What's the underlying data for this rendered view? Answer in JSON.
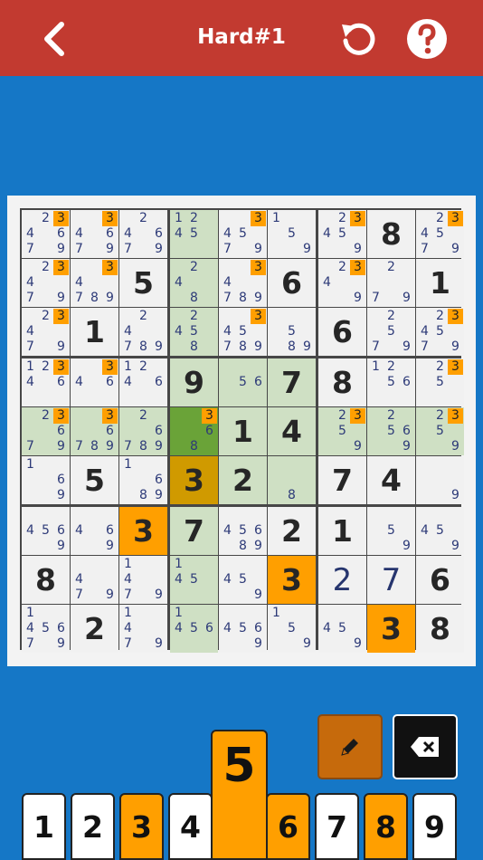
{
  "header": {
    "title": "Hard#1",
    "back_icon": "chevron-left-icon",
    "undo_icon": "undo-icon",
    "help_icon": "help-icon"
  },
  "colors": {
    "topbar": "#c23a30",
    "background": "#1577c6",
    "highlight": "#ff9f00",
    "selected": "#6aa338",
    "block": "#cfe0c4"
  },
  "board": {
    "selected": [
      4,
      3
    ],
    "highlight_number": 3,
    "cells": [
      [
        {
          "n": [
            2,
            3,
            4,
            6,
            7,
            9
          ]
        },
        {
          "n": [
            3,
            4,
            6,
            7,
            9
          ]
        },
        {
          "n": [
            2,
            4,
            6,
            7,
            9
          ]
        },
        {
          "n": [
            1,
            2,
            4,
            5
          ]
        },
        {
          "n": [
            3,
            4,
            5,
            7,
            9
          ]
        },
        {
          "n": [
            1,
            5,
            9
          ]
        },
        {
          "n": [
            2,
            3,
            4,
            5,
            9
          ]
        },
        {
          "v": 8
        },
        {
          "n": [
            2,
            3,
            4,
            5,
            7,
            9
          ]
        }
      ],
      [
        {
          "n": [
            2,
            3,
            4,
            7,
            9
          ]
        },
        {
          "n": [
            3,
            4,
            7,
            8,
            9
          ]
        },
        {
          "v": 5
        },
        {
          "n": [
            2,
            4,
            8
          ]
        },
        {
          "n": [
            3,
            4,
            7,
            8,
            9
          ]
        },
        {
          "v": 6
        },
        {
          "n": [
            2,
            3,
            4,
            9
          ]
        },
        {
          "n": [
            2,
            7,
            9
          ]
        },
        {
          "v": 1
        }
      ],
      [
        {
          "n": [
            2,
            3,
            4,
            7,
            9
          ]
        },
        {
          "v": 1
        },
        {
          "n": [
            2,
            4,
            7,
            8,
            9
          ]
        },
        {
          "n": [
            2,
            4,
            5,
            8
          ]
        },
        {
          "n": [
            3,
            4,
            5,
            7,
            8,
            9
          ]
        },
        {
          "n": [
            5,
            8,
            9
          ]
        },
        {
          "v": 6
        },
        {
          "n": [
            2,
            5,
            7,
            9
          ]
        },
        {
          "n": [
            2,
            3,
            4,
            5,
            7,
            9
          ]
        }
      ],
      [
        {
          "n": [
            1,
            2,
            3,
            4,
            6
          ]
        },
        {
          "n": [
            3,
            4,
            6
          ]
        },
        {
          "n": [
            1,
            2,
            4,
            6
          ]
        },
        {
          "v": 9
        },
        {
          "n": [
            5,
            6
          ]
        },
        {
          "v": 7
        },
        {
          "v": 8
        },
        {
          "n": [
            1,
            2,
            5,
            6
          ]
        },
        {
          "n": [
            2,
            3,
            5
          ]
        }
      ],
      [
        {
          "n": [
            2,
            3,
            6,
            7,
            9
          ]
        },
        {
          "n": [
            3,
            6,
            7,
            8,
            9
          ]
        },
        {
          "n": [
            2,
            6,
            7,
            8,
            9
          ]
        },
        {
          "n": [
            3,
            6,
            8
          ]
        },
        {
          "v": 1
        },
        {
          "v": 4
        },
        {
          "n": [
            2,
            3,
            5,
            9
          ]
        },
        {
          "n": [
            2,
            5,
            6,
            9
          ]
        },
        {
          "n": [
            2,
            3,
            5,
            9
          ]
        }
      ],
      [
        {
          "n": [
            1,
            6,
            9
          ]
        },
        {
          "v": 5
        },
        {
          "n": [
            1,
            6,
            8,
            9
          ]
        },
        {
          "v": 3
        },
        {
          "v": 2
        },
        {
          "n": [
            8
          ]
        },
        {
          "v": 7
        },
        {
          "v": 4
        },
        {
          "n": [
            9
          ]
        }
      ],
      [
        {
          "n": [
            4,
            5,
            6,
            9
          ]
        },
        {
          "n": [
            4,
            6,
            9
          ]
        },
        {
          "v": 3
        },
        {
          "v": 7
        },
        {
          "n": [
            4,
            5,
            6,
            8,
            9
          ]
        },
        {
          "v": 2
        },
        {
          "v": 1
        },
        {
          "n": [
            5,
            9
          ]
        },
        {
          "n": [
            4,
            5,
            9
          ]
        }
      ],
      [
        {
          "v": 8
        },
        {
          "n": [
            4,
            7,
            9
          ]
        },
        {
          "n": [
            1,
            4,
            7,
            9
          ]
        },
        {
          "n": [
            1,
            4,
            5
          ]
        },
        {
          "n": [
            4,
            5,
            9
          ]
        },
        {
          "v": 3
        },
        {
          "v": 2,
          "u": true
        },
        {
          "v": 7,
          "u": true
        },
        {
          "v": 6
        }
      ],
      [
        {
          "n": [
            1,
            4,
            5,
            6,
            7,
            9
          ]
        },
        {
          "v": 2
        },
        {
          "n": [
            1,
            4,
            7,
            9
          ]
        },
        {
          "n": [
            1,
            4,
            5,
            6
          ]
        },
        {
          "n": [
            4,
            5,
            6,
            9
          ]
        },
        {
          "n": [
            1,
            5,
            9
          ]
        },
        {
          "n": [
            4,
            5,
            9
          ]
        },
        {
          "v": 3
        },
        {
          "v": 8
        }
      ]
    ]
  },
  "tools": {
    "pencil_icon": "pencil-icon",
    "erase_icon": "backspace-icon"
  },
  "numpad": {
    "keys": [
      "1",
      "2",
      "3",
      "4",
      "5",
      "6",
      "7",
      "8",
      "9"
    ],
    "active": [
      "3",
      "5",
      "6",
      "8"
    ],
    "lifted": "5"
  }
}
